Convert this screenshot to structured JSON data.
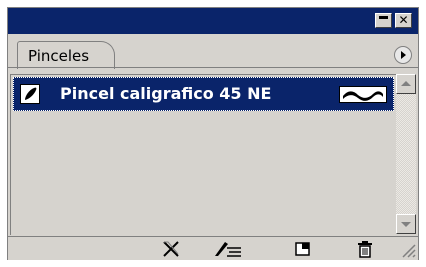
{
  "window": {
    "title_buttons": [
      "minimize-icon",
      "close-icon"
    ],
    "close_glyph": "✕"
  },
  "tabs": [
    {
      "label": "Pinceles",
      "selected": true
    }
  ],
  "menu_button_icon": "panel-menu-arrow-icon",
  "brushes": [
    {
      "name": "Pincel caligrafico 45 NE",
      "selected": true,
      "icon": "calligraphic-brush-icon",
      "preview": "stroke-preview"
    }
  ],
  "bottom_toolbar": [
    {
      "icon": "remove-brush-stroke-icon"
    },
    {
      "icon": "brush-options-icon"
    },
    {
      "icon": "new-brush-icon"
    },
    {
      "icon": "delete-brush-icon"
    }
  ],
  "colors": {
    "title_bar": "#0a246a",
    "selection": "#0a246a",
    "panel": "#d6d3ce"
  }
}
